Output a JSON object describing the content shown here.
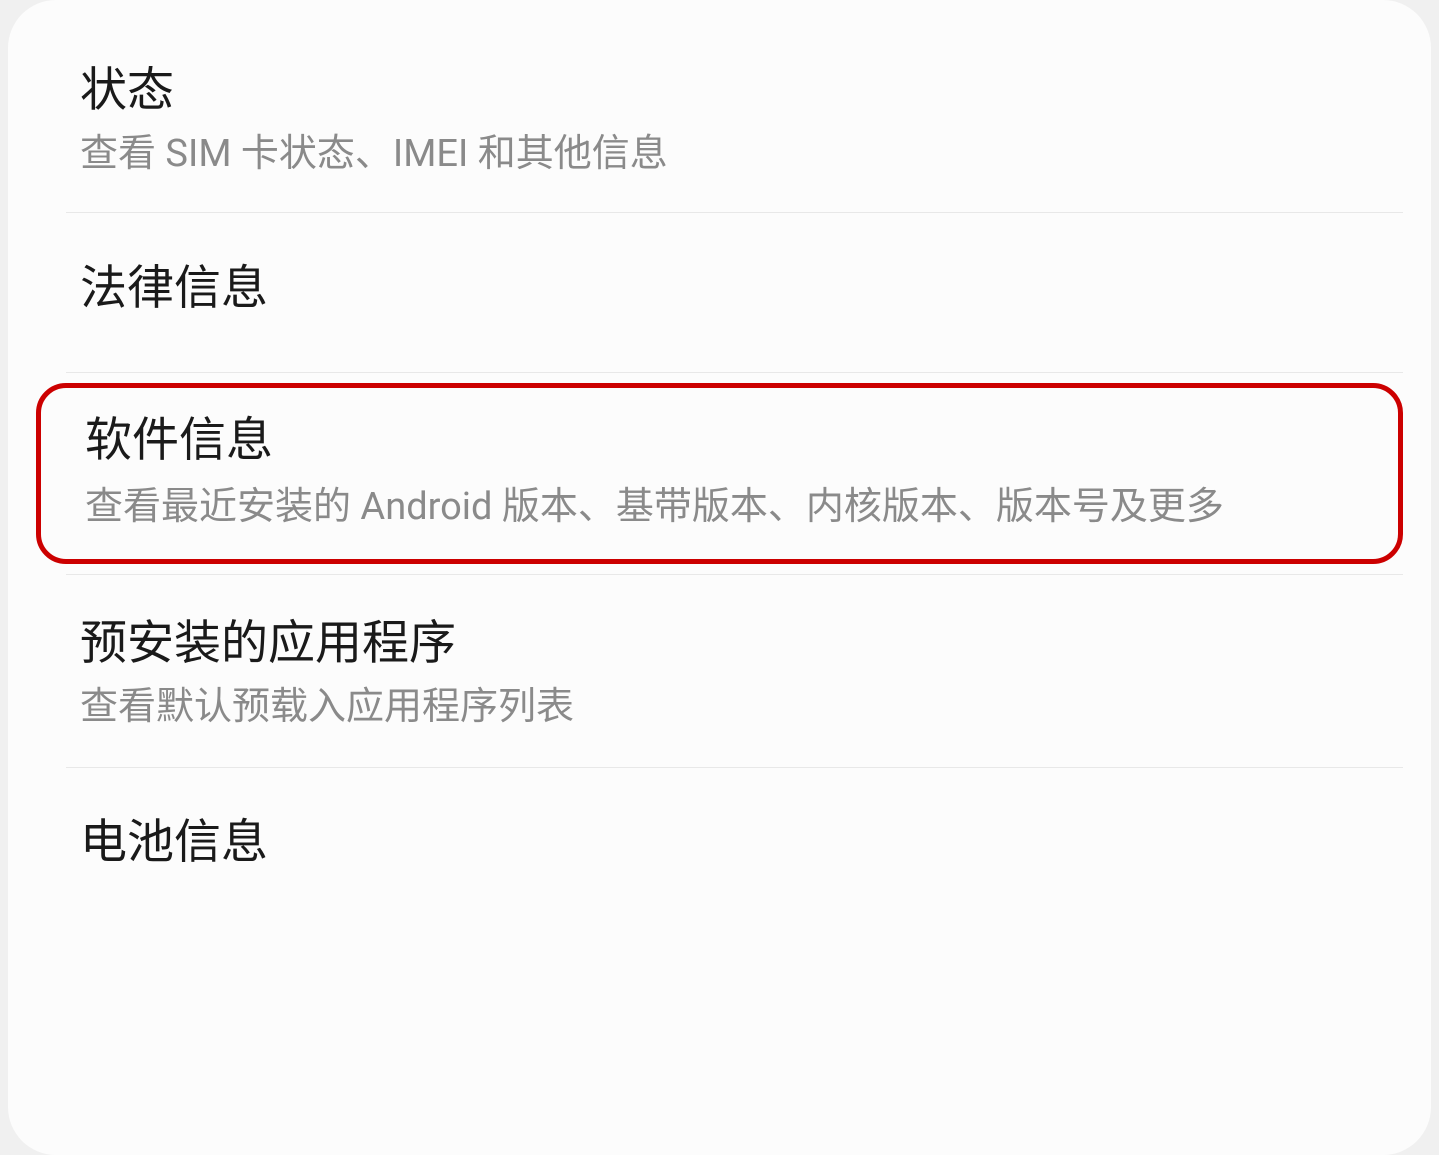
{
  "items": {
    "status": {
      "title": "状态",
      "desc": "查看 SIM 卡状态、IMEI 和其他信息"
    },
    "legal": {
      "title": "法律信息"
    },
    "software": {
      "title": "软件信息",
      "desc": "查看最近安装的 Android 版本、基带版本、内核版本、版本号及更多"
    },
    "preinstalled": {
      "title": "预安装的应用程序",
      "desc": "查看默认预载入应用程序列表"
    },
    "battery": {
      "title": "电池信息"
    }
  }
}
